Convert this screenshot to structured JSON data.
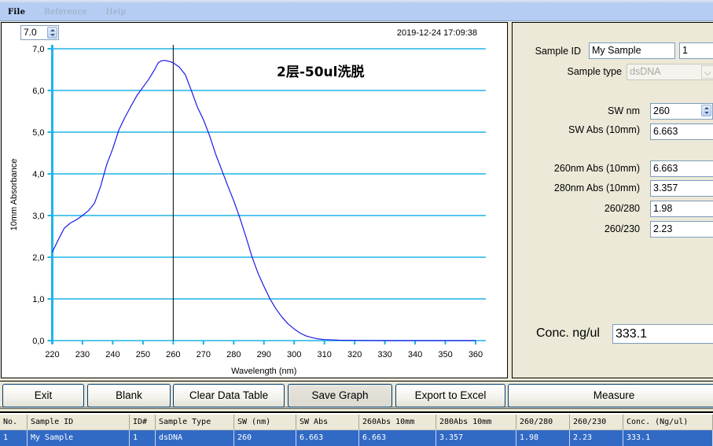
{
  "menu": {
    "items": [
      {
        "label": "File",
        "enabled": true
      },
      {
        "label": "Reference",
        "enabled": false
      },
      {
        "label": "Help",
        "enabled": false
      }
    ]
  },
  "graph": {
    "ymax_value": "7.0",
    "timestamp": "2019-12-24 17:09:38",
    "annotation": "2层-50ul洗脱",
    "cursor_wavelength": 260
  },
  "chart_data": {
    "type": "line",
    "title": "2层-50ul洗脱",
    "xlabel": "Wavelength (nm)",
    "ylabel": "10mm Absorbance",
    "xlim": [
      220,
      360
    ],
    "ylim": [
      0,
      7
    ],
    "x_ticks": [
      220,
      230,
      240,
      250,
      260,
      270,
      280,
      290,
      300,
      310,
      320,
      330,
      340,
      350,
      360
    ],
    "y_ticks": [
      0,
      1,
      2,
      3,
      4,
      5,
      6,
      7
    ],
    "y_tick_labels": [
      "0,0",
      "1,0",
      "2,0",
      "3,0",
      "4,0",
      "5,0",
      "6,0",
      "7,0"
    ],
    "grid": true,
    "line_color": "#1a1ae6",
    "grid_color": "#1eb4e6",
    "marker_line_x": 260,
    "series": [
      {
        "name": "Absorbance",
        "x": [
          220,
          222,
          224,
          226,
          228,
          230,
          232,
          234,
          236,
          238,
          240,
          242,
          244,
          246,
          248,
          250,
          252,
          254,
          255,
          256,
          257,
          258,
          259,
          260,
          262,
          264,
          266,
          268,
          270,
          272,
          274,
          276,
          278,
          280,
          282,
          284,
          286,
          288,
          290,
          292,
          294,
          296,
          298,
          300,
          302,
          304,
          306,
          308,
          310,
          315,
          320,
          330,
          340,
          350,
          360
        ],
        "y": [
          2.12,
          2.42,
          2.7,
          2.82,
          2.9,
          3.0,
          3.12,
          3.3,
          3.7,
          4.22,
          4.6,
          5.05,
          5.35,
          5.62,
          5.88,
          6.08,
          6.28,
          6.52,
          6.66,
          6.71,
          6.72,
          6.71,
          6.69,
          6.663,
          6.56,
          6.38,
          6.0,
          5.6,
          5.3,
          4.92,
          4.48,
          4.1,
          3.72,
          3.357,
          2.95,
          2.5,
          2.02,
          1.62,
          1.3,
          1.0,
          0.76,
          0.56,
          0.4,
          0.28,
          0.18,
          0.11,
          0.07,
          0.04,
          0.025,
          0.01,
          0.005,
          0.0,
          0.0,
          0.0,
          0.0
        ]
      }
    ]
  },
  "controls": {
    "sample_id_label": "Sample ID",
    "sample_id_value": "My Sample",
    "sample_number_value": "1",
    "sample_type_label": "Sample type",
    "sample_type_value": "dsDNA",
    "sw_nm_label": "SW nm",
    "sw_nm_value": "260",
    "sw_abs_label": "SW Abs (10mm)",
    "sw_abs_value": "6.663",
    "abs260_label": "260nm Abs (10mm)",
    "abs260_value": "6.663",
    "abs280_label": "280nm Abs (10mm)",
    "abs280_value": "3.357",
    "ratio_260_280_label": "260/280",
    "ratio_260_280_value": "1.98",
    "ratio_260_230_label": "260/230",
    "ratio_260_230_value": "2.23",
    "conc_label": "Conc. ng/ul",
    "conc_value": "333.1"
  },
  "buttons": {
    "exit": "Exit",
    "blank": "Blank",
    "clear": "Clear Data Table",
    "save": "Save Graph",
    "export": "Export to Excel",
    "measure": "Measure"
  },
  "table": {
    "columns": [
      "No.",
      "Sample ID",
      "ID#",
      "Sample Type",
      "SW (nm)",
      "SW Abs",
      "260Abs 10mm",
      "280Abs 10mm",
      "260/280",
      "260/230",
      "Conc. (Ng/ul)"
    ],
    "rows": [
      [
        "1",
        "My Sample",
        "1",
        "dsDNA",
        "260",
        "6.663",
        "6.663",
        "3.357",
        "1.98",
        "2.23",
        "333.1"
      ]
    ]
  }
}
